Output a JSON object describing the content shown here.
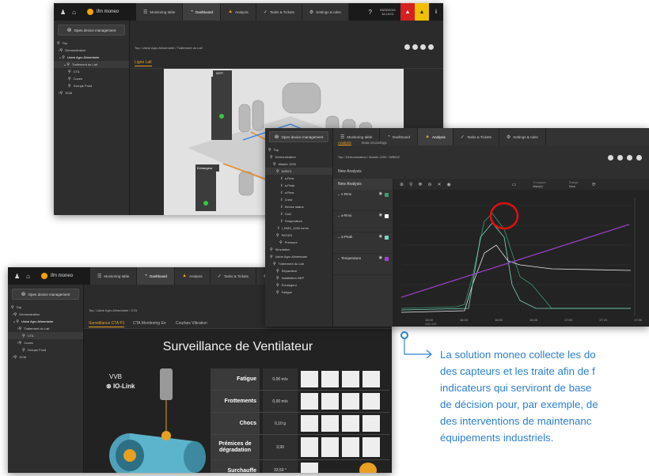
{
  "win1": {
    "brand": "ifm moneo",
    "tabs": [
      {
        "icon": "☰",
        "label": "Monitoring table"
      },
      {
        "icon": "◔",
        "label": "Dashboard"
      },
      {
        "icon": "▲",
        "label": "Analysis"
      },
      {
        "icon": "✓",
        "label": "Tasks & Tickets"
      },
      {
        "icon": "⚙",
        "label": "Settings & rules"
      }
    ],
    "date": "03/02/2021",
    "time": "16:13:01",
    "open_button": "Open device management",
    "tree": [
      "Top",
      "Demonstration",
      "Usine Agro Alimentaire",
      "Traitement du Lait",
      "CTA",
      "Cuves",
      "Groupe Froid",
      "SCM"
    ],
    "breadcrumb": "Top / Usine Agro Alimentaire / Traitement du Lait",
    "section_tab": "Ligne Lait",
    "labels": {
      "wtp": "WTP",
      "exchanger": "Echangeur",
      "separator": "Séparateur"
    }
  },
  "win2": {
    "tabs": [
      {
        "icon": "☰",
        "label": "Monitoring table"
      },
      {
        "icon": "◔",
        "label": "Dashboard"
      },
      {
        "icon": "▲",
        "label": "Analysis"
      },
      {
        "icon": "✓",
        "label": "Tasks & Tickets"
      },
      {
        "icon": "⚙",
        "label": "Settings & rules"
      }
    ],
    "subtabs": [
      "Analysis",
      "Data recordings"
    ],
    "open_button": "Open device management",
    "breadcrumb": "Top / Demonstration / Master 1200 / WB002",
    "new_analysis": "New Analysis",
    "panel_title": "New Analysis",
    "tree": [
      "Top",
      "Demonstration",
      "Master 1200",
      "WB001",
      "a-Rms",
      "a-Peak",
      "a-Rms",
      "Crest",
      "Device status",
      "Out1",
      "Temperature",
      "I_RMS_1250 mm/s",
      "PAT001",
      "Pressure",
      "Simulation",
      "Usine Agro Alimentaire",
      "Traitement du Lait",
      "Séparateur",
      "Installation NEP",
      "Echangeur",
      "Fatigue"
    ],
    "series": [
      {
        "name": "v-Rms",
        "color": "#3a9c6e"
      },
      {
        "name": "a-Rms",
        "color": "#ffffff"
      },
      {
        "name": "a-Peak",
        "color": "#7ad6c0"
      },
      {
        "name": "Temperature",
        "color": "#a040d0"
      }
    ],
    "compare_label": "Compare",
    "compare_value": "Max(s)",
    "range_label": "Range",
    "range_value": "Now",
    "x_ticks": [
      "16:00",
      "16:15",
      "16:30",
      "16:45",
      "17:00",
      "17:15",
      "17:30"
    ],
    "x_sub": "16th JAN"
  },
  "win3": {
    "brand": "ifm moneo",
    "tabs": [
      {
        "icon": "☰",
        "label": "Monitoring table"
      },
      {
        "icon": "◔",
        "label": "Dashboard"
      },
      {
        "icon": "▲",
        "label": "Analysis"
      },
      {
        "icon": "✓",
        "label": "Tasks & Tickets"
      },
      {
        "icon": "⚙",
        "label": "Settings & ru"
      }
    ],
    "open_button": "Open device management",
    "tree": [
      "Top",
      "Demonstration",
      "Usine Agro Alimentaire",
      "Traitement du Lait",
      "CTA",
      "Cuves",
      "Groupe Froid",
      "SCM"
    ],
    "breadcrumb": "Top / Usine Agro Alimentaire / CTA",
    "section_tabs": [
      "Surveillance CTA P1",
      "CTA Monitoring En",
      "Courbes Vibration"
    ],
    "title": "Surveillance de Ventilateur",
    "sensor_model": "VVB",
    "iolink": "IO-Link",
    "rows": [
      {
        "label": "Fatigue",
        "value": "0,00 m/s"
      },
      {
        "label": "Frottements",
        "value": "0,00 m/s"
      },
      {
        "label": "Chocs",
        "value": "0,10 g"
      },
      {
        "label": "Prémices de dégradation",
        "value": "3,90"
      },
      {
        "label": "Surchauffe",
        "value": "33,50 °"
      }
    ]
  },
  "caption": [
    "La solution moneo collecte les do",
    "des capteurs et les traite afin de f",
    "indicateurs qui serviront de base",
    "de décision pour, par exemple, de",
    "des interventions de maintenanc",
    "équipements industriels."
  ]
}
